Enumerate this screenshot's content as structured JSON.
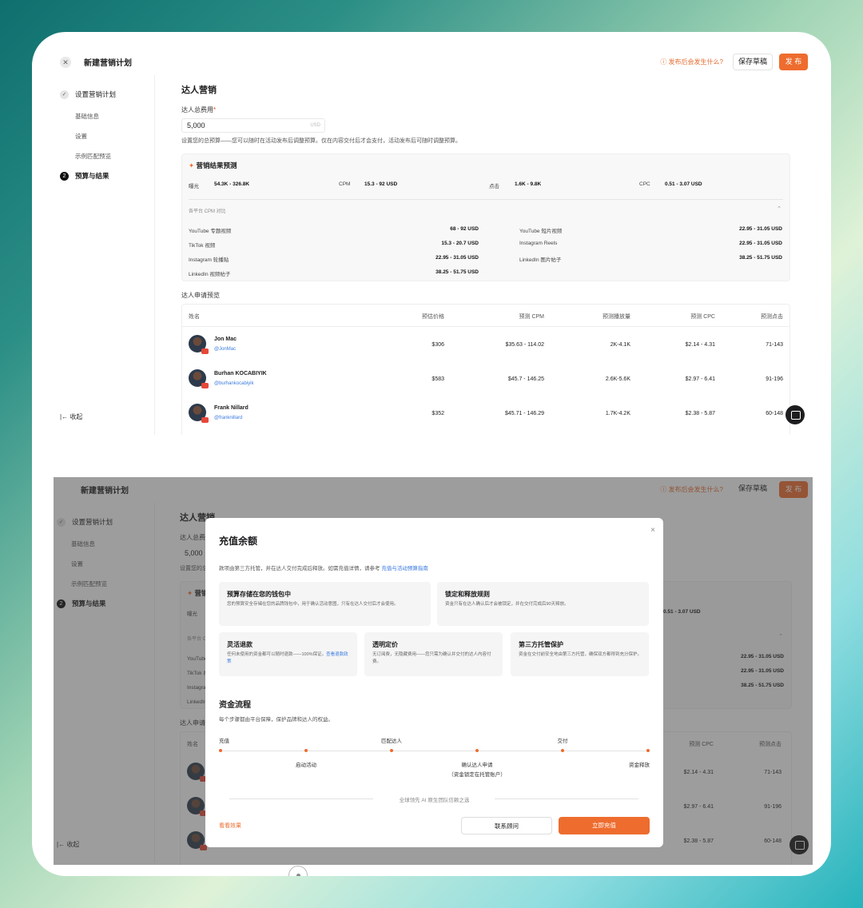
{
  "app": {
    "title": "新建营销计划",
    "what_next": "ⓘ 发布后会发生什么?",
    "save_draft": "保存草稿",
    "publish": "发 布"
  },
  "sidebar": {
    "step1": "设置营销计划",
    "sub1": "基础信息",
    "sub2": "设置",
    "sub3": "示例匹配预览",
    "step2": "预算与结果",
    "step2_num": "2",
    "collapse": "收起"
  },
  "main": {
    "heading": "达人营销",
    "budget_label": "达人总费用",
    "budget_value": "5,000",
    "budget_unit": "USD",
    "budget_note": "设置您的总预算——您可以随时在活动发布后调整预算。仅在内容交付后才会支付，活动发布后可随时调整预算。",
    "forecast": {
      "title": "营销结果预测",
      "metrics": [
        {
          "label": "曝光",
          "value": "54.3K - 326.8K"
        },
        {
          "label": "CPM",
          "value": "15.3 - 92 USD"
        },
        {
          "label": "点击",
          "value": "1.6K - 9.8K"
        },
        {
          "label": "CPC",
          "value": "0.51 - 3.07 USD"
        }
      ],
      "cpm_title": "各平台 CPM 对比",
      "cpm_left": [
        {
          "name": "YouTube 专题视频",
          "value": "68 - 92 USD"
        },
        {
          "name": "TikTok 视频",
          "value": "15.3 - 20.7 USD"
        },
        {
          "name": "Instagram 轮播贴",
          "value": "22.95 - 31.05 USD"
        },
        {
          "name": "LinkedIn 视频帖子",
          "value": "38.25 - 51.75 USD"
        }
      ],
      "cpm_right": [
        {
          "name": "YouTube 短片视频",
          "value": "22.95 - 31.05 USD"
        },
        {
          "name": "Instagram Reels",
          "value": "22.95 - 31.05 USD"
        },
        {
          "name": "LinkedIn 图片帖子",
          "value": "38.25 - 51.75 USD"
        }
      ]
    },
    "applicants_title": "达人申请预览",
    "columns": [
      "姓名",
      "预估价格",
      "预测 CPM",
      "预测播放量",
      "预测 CPC",
      "预测点击"
    ],
    "rows": [
      {
        "name": "Jon Mac",
        "handle": "@JonMac",
        "price": "$306",
        "cpm": "$35.63 - 114.02",
        "views": "2K-4.1K",
        "cpc": "$2.14 - 4.31",
        "clicks": "71-143"
      },
      {
        "name": "Burhan KOCABIYIK",
        "handle": "@burhankocabiyik",
        "price": "$583",
        "cpm": "$45.7 - 146.25",
        "views": "2.6K-5.6K",
        "cpc": "$2.97 - 6.41",
        "clicks": "91-196"
      },
      {
        "name": "Frank Nillard",
        "handle": "@franknillard",
        "price": "$352",
        "cpm": "$45.71 - 146.29",
        "views": "1.7K-4.2K",
        "cpc": "$2.38 - 5.87",
        "clicks": "60-148"
      }
    ]
  },
  "modal": {
    "title": "充值余额",
    "close": "×",
    "intro": "款项由第三方托管，并在达人交付完成后释放。如需充值详情，请参考",
    "intro_link": "充值与活动预算指南",
    "cards": [
      {
        "title": "预算存储在您的钱包中",
        "desc": "您的预算安全存储在您的品牌钱包中，用于确认活动意图，只有在达人交付后才会使用。"
      },
      {
        "title": "锁定和释放规则",
        "desc": "资金只有在达人确认后才会被锁定，并在交付完成后90天释放。"
      },
      {
        "title": "灵活退款",
        "desc": "任何未使用的资金都可以随时退款——100%保证。",
        "link": "查看退款政策"
      },
      {
        "title": "透明定价",
        "desc": "无订阅费，无隐藏费用——您只需为确认并交付的达人内容付费。"
      },
      {
        "title": "第三方托管保护",
        "desc": "资金在交付前安全地由第三方托管，确保双方都得到充分保护。"
      }
    ],
    "flow_title": "资金流程",
    "flow_sub": "每个步骤都由平台保障，保护品牌和达人的权益。",
    "flow_top": [
      "充值",
      "匹配达人",
      "交付"
    ],
    "flow_bottom": [
      "启动活动",
      "确认达人申请",
      "（资金锁定在托管账户）",
      "资金释放"
    ],
    "trust": "全球领先 AI 原生团队信赖之选",
    "view_effect": "看看效果",
    "contact": "联系顾问",
    "recharge": "立即充值"
  }
}
